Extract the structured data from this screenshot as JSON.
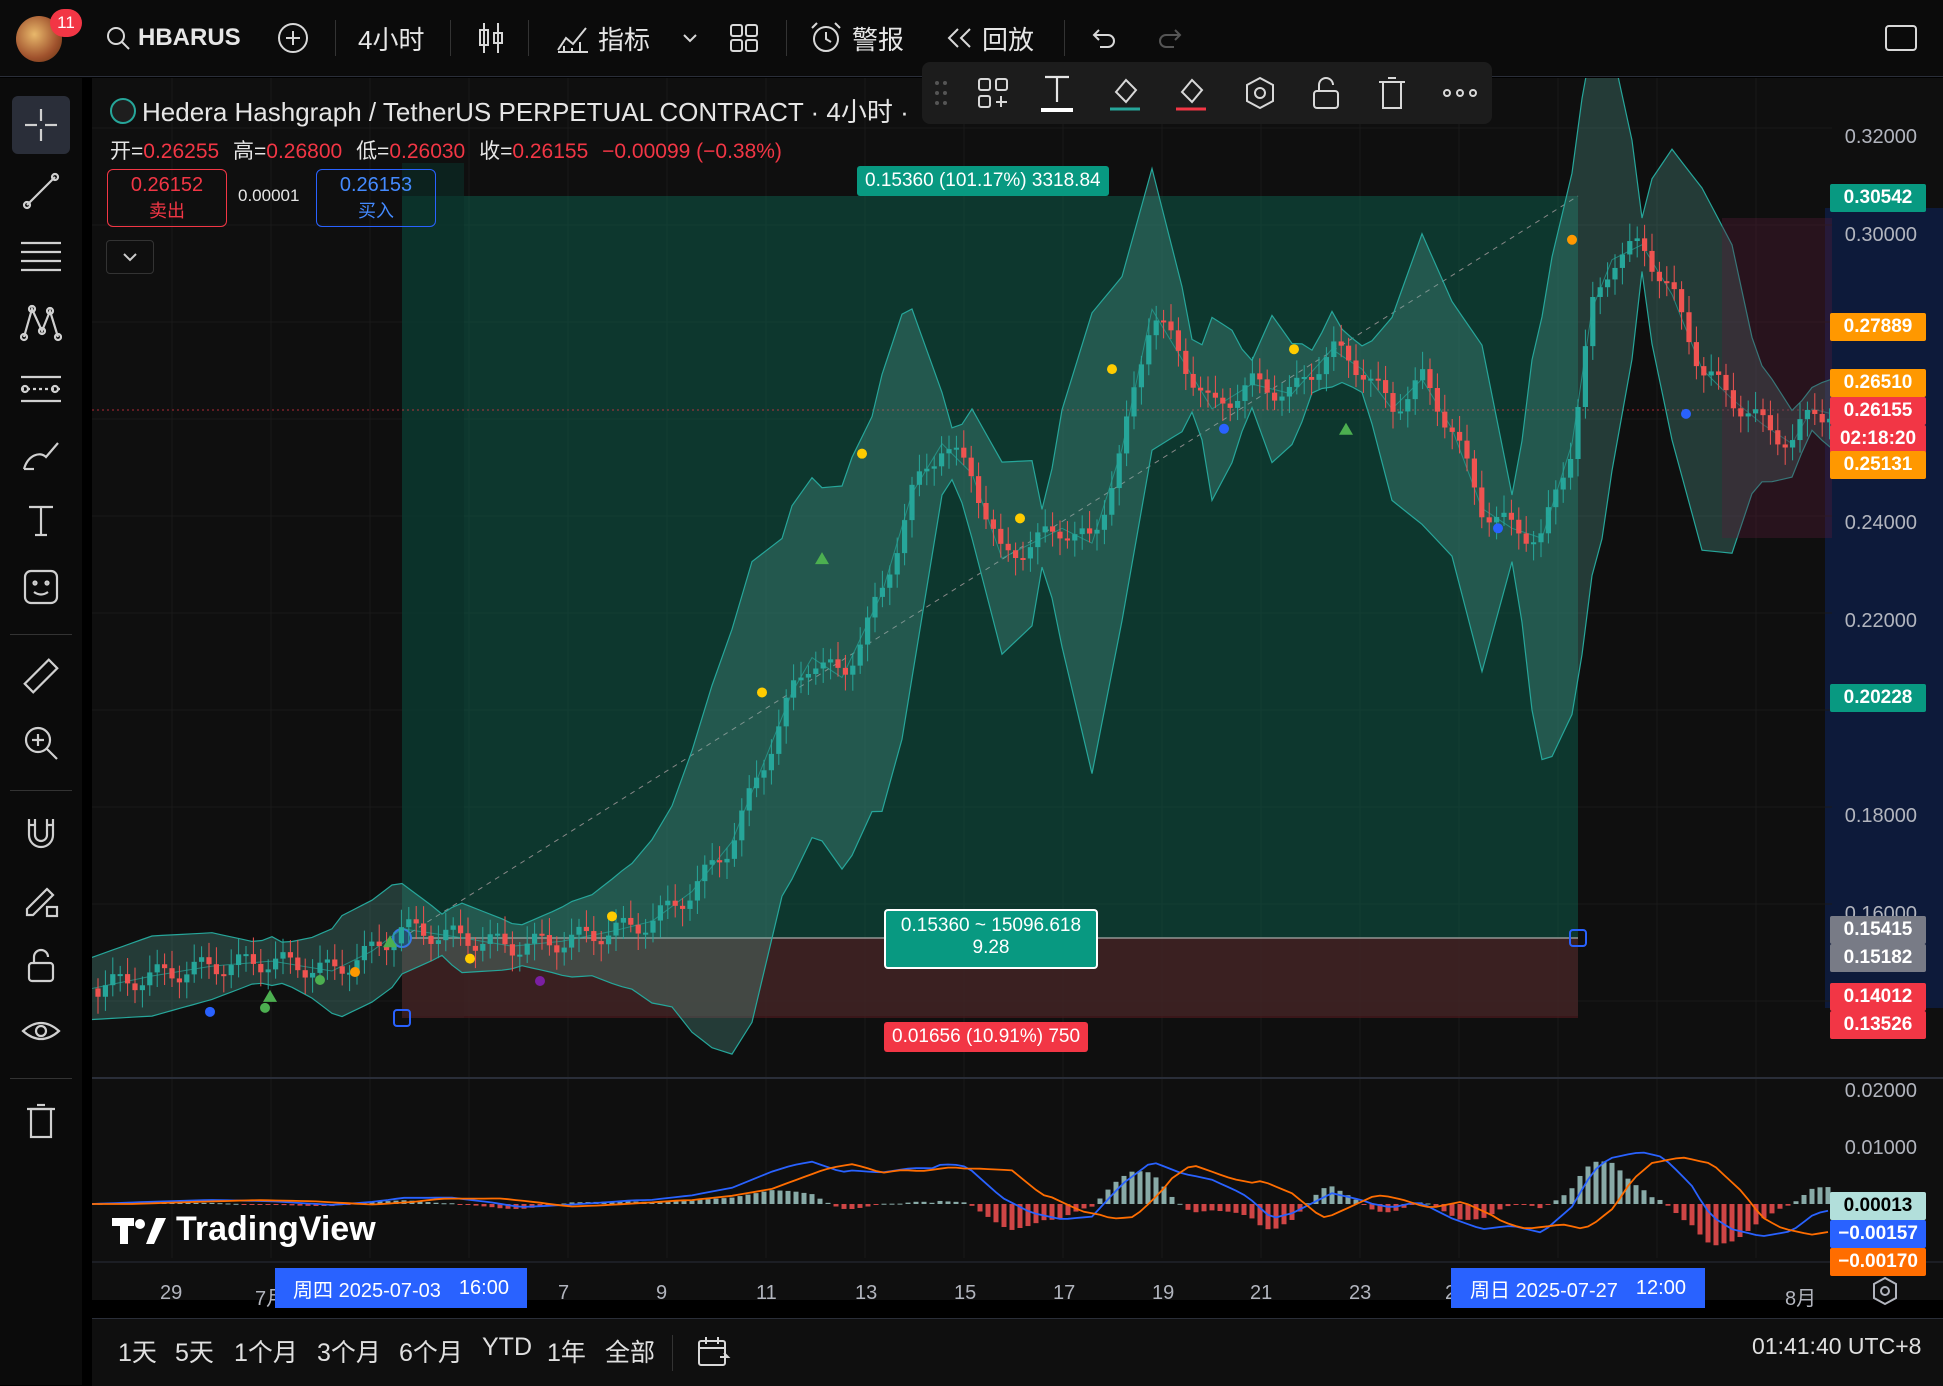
{
  "topbar": {
    "notif_count": "11",
    "symbol": "HBARUSD",
    "interval": "4小时",
    "indicators_label": "指标",
    "alert_label": "警报",
    "replay_label": "回放"
  },
  "legend": {
    "title": "Hedera Hashgraph / TetherUS PERPETUAL CONTRACT · 4小时 ·",
    "open_label": "开=",
    "open": "0.26255",
    "high_label": "高=",
    "high": "0.26800",
    "low_label": "低=",
    "low": "0.26030",
    "close_label": "收=",
    "close": "0.26155",
    "change": "−0.00099 (−0.38%)",
    "sell_price": "0.26152",
    "sell_label": "卖出",
    "spread": "0.00001",
    "buy_price": "0.26153",
    "buy_label": "买入"
  },
  "position": {
    "target_label": "0.15360 (101.17%) 3318.84",
    "entry_label_1": "0.15360 ~ 15096.618",
    "entry_label_2": "9.28",
    "stop_label": "0.01656 (10.91%) 750"
  },
  "price_axis": {
    "ticks": [
      "0.32000",
      "0.30000",
      "0.24000",
      "0.22000",
      "0.18000",
      "0.16000"
    ],
    "tags": [
      {
        "text": "0.30542",
        "color": "#089981"
      },
      {
        "text": "0.27889",
        "color": "#ff9800"
      },
      {
        "text": "0.26510",
        "color": "#ff9800"
      },
      {
        "text": "0.26155",
        "color": "#f23645"
      },
      {
        "text": "02:18:20",
        "color": "#f23645"
      },
      {
        "text": "0.25131",
        "color": "#ff9800"
      },
      {
        "text": "0.20228",
        "color": "#089981"
      },
      {
        "text": "0.15415",
        "color": "#787b86"
      },
      {
        "text": "0.15182",
        "color": "#787b86"
      },
      {
        "text": "0.14012",
        "color": "#f23645"
      },
      {
        "text": "0.13526",
        "color": "#f23645"
      }
    ],
    "macd_ticks": [
      "0.02000",
      "0.01000"
    ],
    "macd_tags": [
      {
        "text": "0.00013",
        "color": "#b2dfdb"
      },
      {
        "text": "−0.00157",
        "color": "#2962ff"
      },
      {
        "text": "−0.00170",
        "color": "#ff6d00"
      }
    ]
  },
  "time_axis": {
    "labels": [
      "29",
      "7月",
      "7",
      "9",
      "11",
      "13",
      "15",
      "17",
      "19",
      "21",
      "23",
      "2",
      "8月"
    ],
    "range_start": "周四 2025-07-03",
    "range_start_time": "16:00",
    "range_end": "周日 2025-07-27",
    "range_end_time": "12:00"
  },
  "watermark": "TradingView",
  "bottombar": {
    "ranges": [
      "1天",
      "5天",
      "1个月",
      "3个月",
      "6个月",
      "YTD",
      "1年",
      "全部"
    ],
    "clock": "01:41:40 UTC+8"
  },
  "colors": {
    "up": "#26a69a",
    "down": "#ef5350",
    "accent": "#2962ff",
    "bg": "#0f0f0f"
  }
}
